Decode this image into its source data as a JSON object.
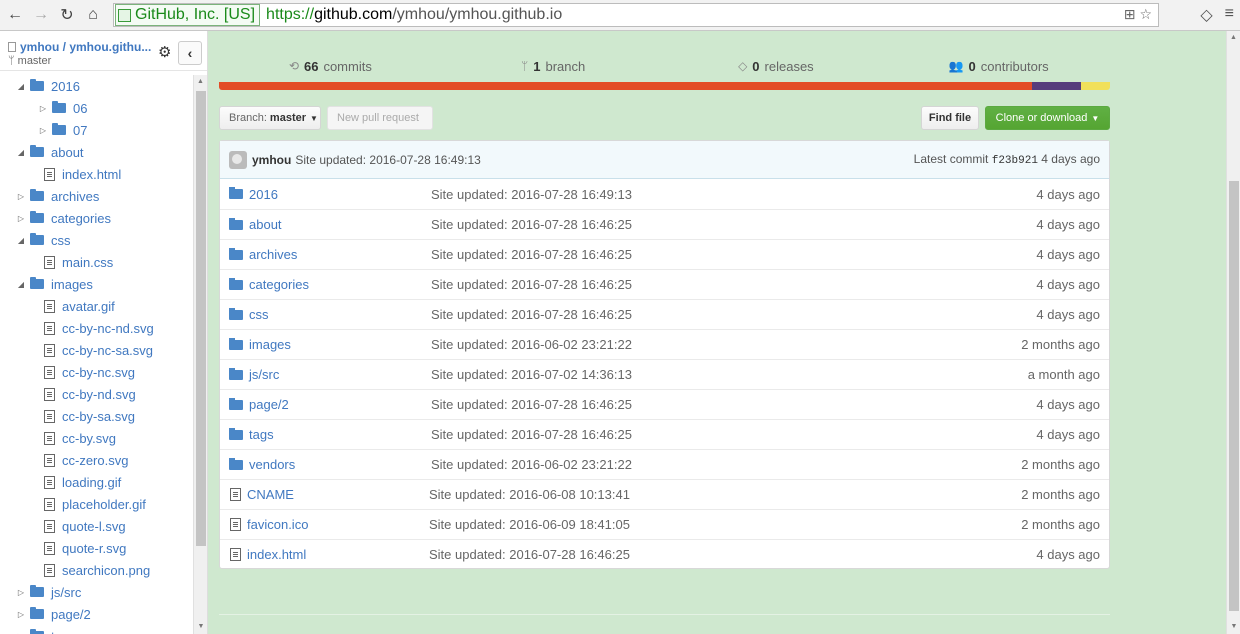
{
  "browser": {
    "ev_label": "GitHub, Inc. [US]",
    "url_scheme": "https://",
    "url_host": "github.com",
    "url_path": "/ymhou/ymhou.github.io"
  },
  "sidebar": {
    "repo": "ymhou / ymhou.githu...",
    "branch": "master",
    "tree": [
      {
        "label": "2016",
        "type": "folder",
        "depth": 0,
        "toggle": "expanded"
      },
      {
        "label": "06",
        "type": "folder",
        "depth": 1,
        "toggle": "collapsed"
      },
      {
        "label": "07",
        "type": "folder",
        "depth": 1,
        "toggle": "collapsed"
      },
      {
        "label": "about",
        "type": "folder",
        "depth": 0,
        "toggle": "expanded"
      },
      {
        "label": "index.html",
        "type": "file",
        "depth": 1,
        "toggle": "none"
      },
      {
        "label": "archives",
        "type": "folder",
        "depth": 0,
        "toggle": "collapsed"
      },
      {
        "label": "categories",
        "type": "folder",
        "depth": 0,
        "toggle": "collapsed"
      },
      {
        "label": "css",
        "type": "folder",
        "depth": 0,
        "toggle": "expanded"
      },
      {
        "label": "main.css",
        "type": "file",
        "depth": 1,
        "toggle": "none"
      },
      {
        "label": "images",
        "type": "folder",
        "depth": 0,
        "toggle": "expanded"
      },
      {
        "label": "avatar.gif",
        "type": "file",
        "depth": 1,
        "toggle": "none"
      },
      {
        "label": "cc-by-nc-nd.svg",
        "type": "file",
        "depth": 1,
        "toggle": "none"
      },
      {
        "label": "cc-by-nc-sa.svg",
        "type": "file",
        "depth": 1,
        "toggle": "none"
      },
      {
        "label": "cc-by-nc.svg",
        "type": "file",
        "depth": 1,
        "toggle": "none"
      },
      {
        "label": "cc-by-nd.svg",
        "type": "file",
        "depth": 1,
        "toggle": "none"
      },
      {
        "label": "cc-by-sa.svg",
        "type": "file",
        "depth": 1,
        "toggle": "none"
      },
      {
        "label": "cc-by.svg",
        "type": "file",
        "depth": 1,
        "toggle": "none"
      },
      {
        "label": "cc-zero.svg",
        "type": "file",
        "depth": 1,
        "toggle": "none"
      },
      {
        "label": "loading.gif",
        "type": "file",
        "depth": 1,
        "toggle": "none"
      },
      {
        "label": "placeholder.gif",
        "type": "file",
        "depth": 1,
        "toggle": "none"
      },
      {
        "label": "quote-l.svg",
        "type": "file",
        "depth": 1,
        "toggle": "none"
      },
      {
        "label": "quote-r.svg",
        "type": "file",
        "depth": 1,
        "toggle": "none"
      },
      {
        "label": "searchicon.png",
        "type": "file",
        "depth": 1,
        "toggle": "none"
      },
      {
        "label": "js/src",
        "type": "folder",
        "depth": 0,
        "toggle": "collapsed"
      },
      {
        "label": "page/2",
        "type": "folder",
        "depth": 0,
        "toggle": "collapsed"
      },
      {
        "label": "tags",
        "type": "folder",
        "depth": 0,
        "toggle": "collapsed"
      }
    ]
  },
  "summary": {
    "commits_count": "66",
    "commits_label": "commits",
    "branch_count": "1",
    "branch_label": "branch",
    "releases_count": "0",
    "releases_label": "releases",
    "contributors_count": "0",
    "contributors_label": "contributors"
  },
  "language_bar": [
    {
      "color": "#e34c26",
      "share": 0.912
    },
    {
      "color": "#563d7c",
      "share": 0.055
    },
    {
      "color": "#f1e05a",
      "share": 0.033
    }
  ],
  "toolbar": {
    "branch_prefix": "Branch:",
    "branch_name": "master",
    "new_pr": "New pull request",
    "find_file": "Find file",
    "clone": "Clone or download"
  },
  "latest_commit": {
    "author": "ymhou",
    "message": "Site updated: 2016-07-28 16:49:13",
    "label": "Latest commit",
    "sha": "f23b921",
    "age": "4 days ago"
  },
  "files": [
    {
      "name": "2016",
      "type": "folder",
      "message": "Site updated: 2016-07-28 16:49:13",
      "age": "4 days ago"
    },
    {
      "name": "about",
      "type": "folder",
      "message": "Site updated: 2016-07-28 16:46:25",
      "age": "4 days ago"
    },
    {
      "name": "archives",
      "type": "folder",
      "message": "Site updated: 2016-07-28 16:46:25",
      "age": "4 days ago"
    },
    {
      "name": "categories",
      "type": "folder",
      "message": "Site updated: 2016-07-28 16:46:25",
      "age": "4 days ago"
    },
    {
      "name": "css",
      "type": "folder",
      "message": "Site updated: 2016-07-28 16:46:25",
      "age": "4 days ago"
    },
    {
      "name": "images",
      "type": "folder",
      "message": "Site updated: 2016-06-02 23:21:22",
      "age": "2 months ago"
    },
    {
      "name": "js/src",
      "type": "folder",
      "message": "Site updated: 2016-07-02 14:36:13",
      "age": "a month ago"
    },
    {
      "name": "page/2",
      "type": "folder",
      "message": "Site updated: 2016-07-28 16:46:25",
      "age": "4 days ago"
    },
    {
      "name": "tags",
      "type": "folder",
      "message": "Site updated: 2016-07-28 16:46:25",
      "age": "4 days ago"
    },
    {
      "name": "vendors",
      "type": "folder",
      "message": "Site updated: 2016-06-02 23:21:22",
      "age": "2 months ago"
    },
    {
      "name": "CNAME",
      "type": "file",
      "message": "Site updated: 2016-06-08 10:13:41",
      "age": "2 months ago"
    },
    {
      "name": "favicon.ico",
      "type": "file",
      "message": "Site updated: 2016-06-09 18:41:05",
      "age": "2 months ago"
    },
    {
      "name": "index.html",
      "type": "file",
      "message": "Site updated: 2016-07-28 16:46:25",
      "age": "4 days ago"
    }
  ]
}
